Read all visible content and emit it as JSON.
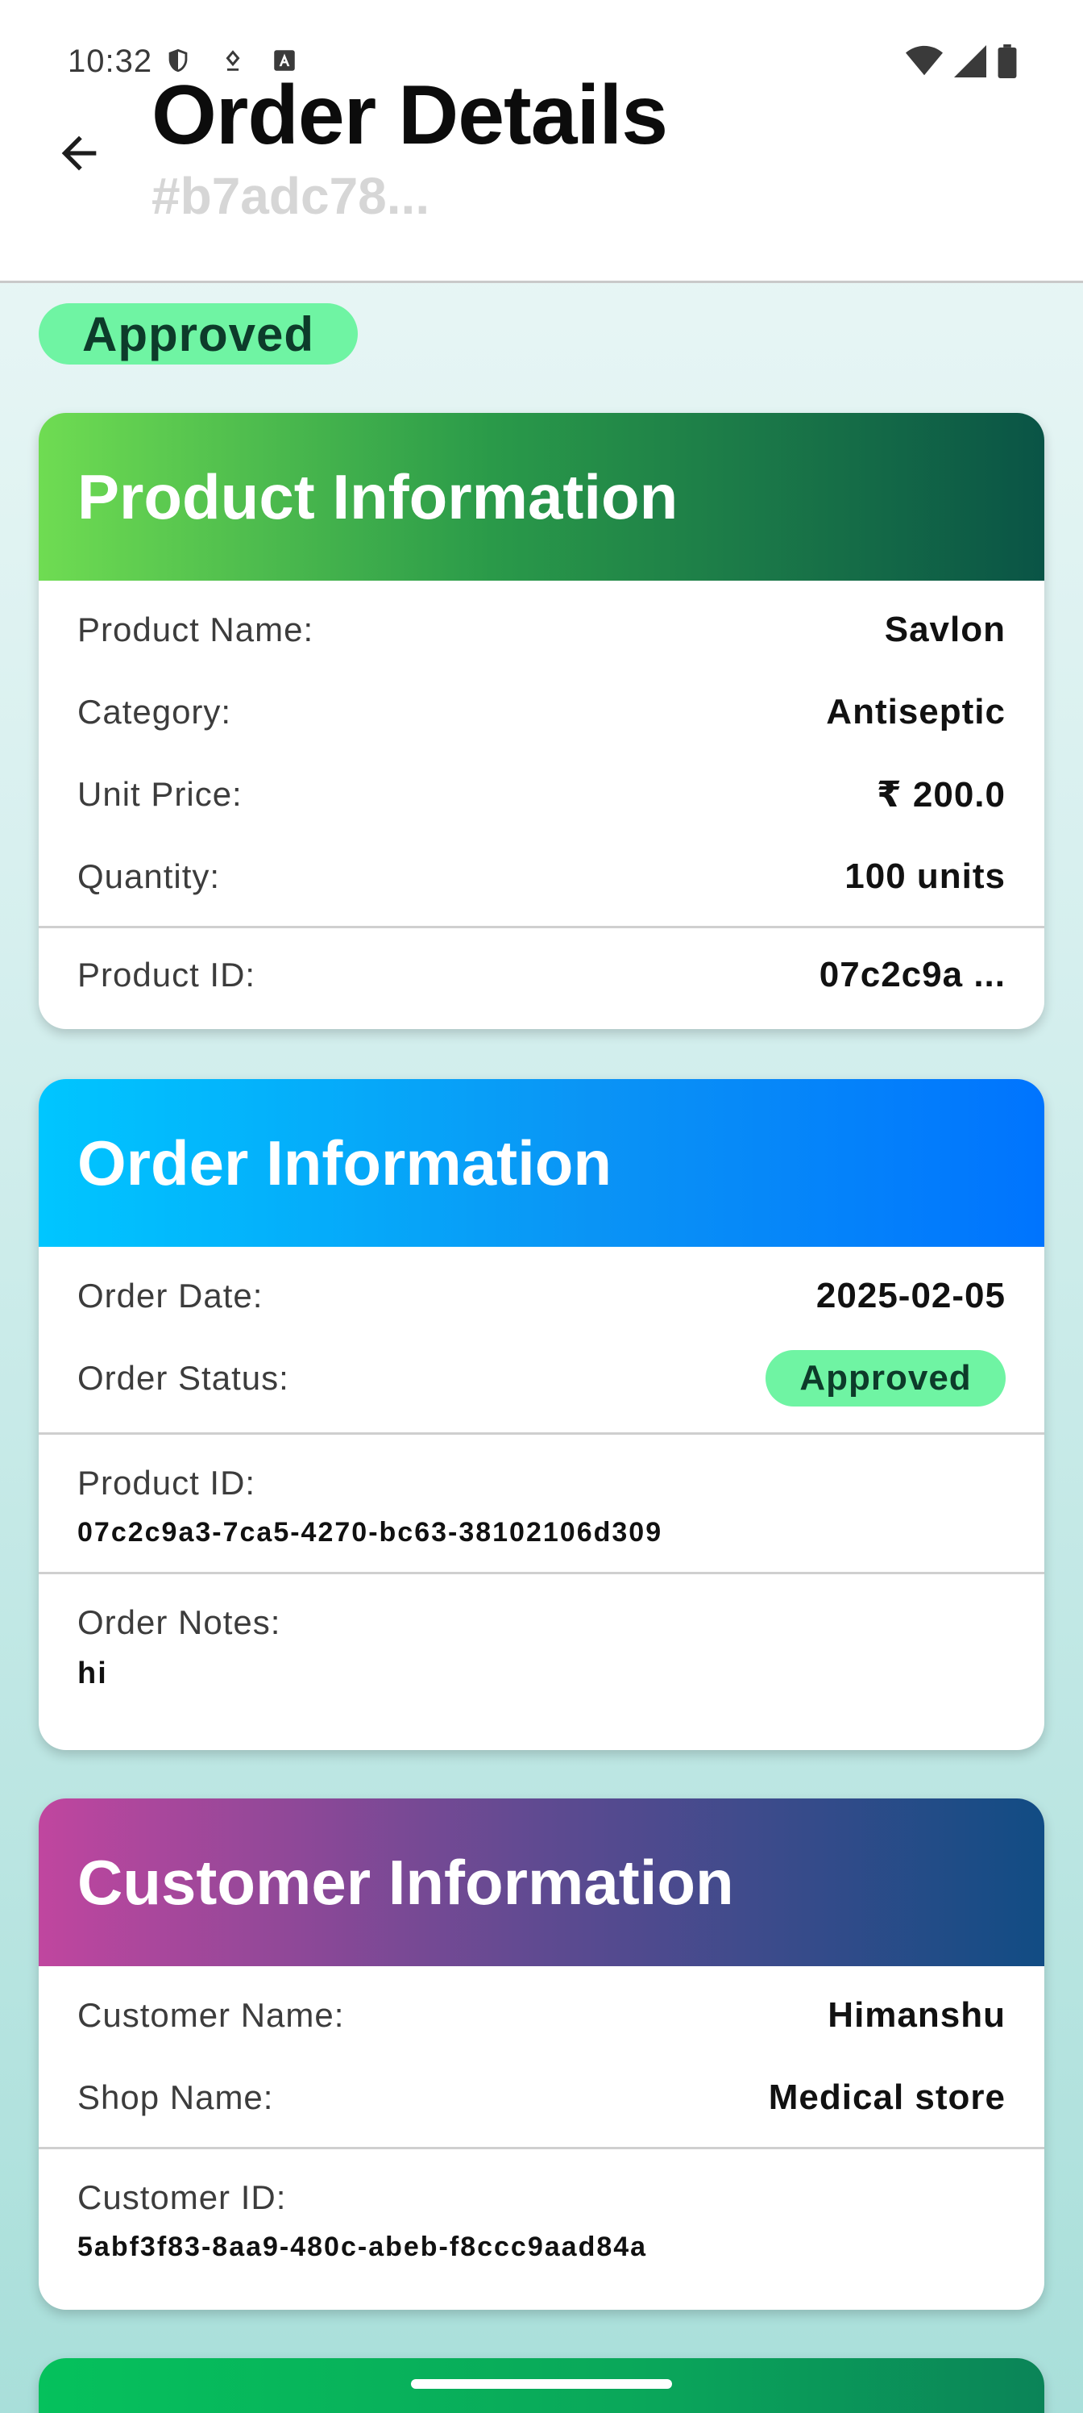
{
  "status_bar": {
    "time": "10:32",
    "left_icons": [
      "shield-icon",
      "notification-icon",
      "accessibility-icon"
    ],
    "right_icons": [
      "wifi-icon",
      "signal-icon",
      "battery-icon"
    ]
  },
  "app_bar": {
    "title": "Order Details",
    "subtitle": "#b7adc78..."
  },
  "status_chip": "Approved",
  "product_card": {
    "title": "Product Information",
    "rows": [
      {
        "label": "Product Name:",
        "value": "Savlon"
      },
      {
        "label": "Category:",
        "value": "Antiseptic"
      },
      {
        "label": "Unit Price:",
        "value": "₹ 200.0"
      },
      {
        "label": "Quantity:",
        "value": "100 units"
      }
    ],
    "product_id_label": "Product ID:",
    "product_id_value": "07c2c9a ..."
  },
  "order_card": {
    "title": "Order Information",
    "date_label": "Order Date:",
    "date_value": "2025-02-05",
    "status_label": "Order Status:",
    "status_value": "Approved",
    "product_id_label": "Product ID:",
    "product_id_value": "07c2c9a3-7ca5-4270-bc63-38102106d309",
    "notes_label": "Order Notes:",
    "notes_value": "hi"
  },
  "customer_card": {
    "title": "Customer Information",
    "rows": [
      {
        "label": "Customer Name:",
        "value": "Himanshu"
      },
      {
        "label": "Shop Name:",
        "value": "Medical store"
      }
    ],
    "customer_id_label": "Customer ID:",
    "customer_id_value": "5abf3f83-8aa9-480c-abeb-f8ccc9aad84a"
  },
  "colors": {
    "approved_chip": "#6ff4a3",
    "product_gradient": [
      "#6fdc52",
      "#0a5446"
    ],
    "order_gradient": [
      "#00c6ff",
      "#0074fe"
    ],
    "customer_gradient": [
      "#c0469f",
      "#114c84"
    ],
    "next_card_gradient": [
      "#05c15c",
      "#0b8458"
    ]
  }
}
